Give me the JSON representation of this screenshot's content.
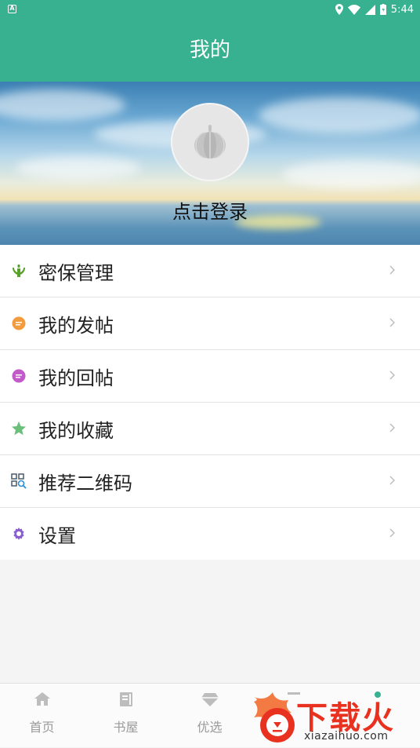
{
  "status_bar": {
    "time": "5:44",
    "notification_icon": "A"
  },
  "app_bar": {
    "title": "我的"
  },
  "profile": {
    "login_text": "点击登录",
    "avatar_icon": "pumpkin-icon"
  },
  "menu": [
    {
      "label": "密保管理",
      "icon": "security-hands-icon",
      "color": "#5aa02c"
    },
    {
      "label": "我的发帖",
      "icon": "chat-bubble-icon",
      "color": "#f39c3d"
    },
    {
      "label": "我的回帖",
      "icon": "chat-bubble-icon",
      "color": "#c25bc9"
    },
    {
      "label": "我的收藏",
      "icon": "star-icon",
      "color": "#6cbf7a"
    },
    {
      "label": "推荐二维码",
      "icon": "qr-search-icon",
      "color": "#6a7a8a"
    },
    {
      "label": "设置",
      "icon": "gear-icon",
      "color": "#8a5fd0"
    }
  ],
  "tabs": [
    {
      "label": "首页",
      "icon": "home-icon"
    },
    {
      "label": "书屋",
      "icon": "book-icon"
    },
    {
      "label": "优选",
      "icon": "diamond-icon"
    },
    {
      "label": "",
      "icon": "list-icon"
    },
    {
      "label": "",
      "icon": "person-icon"
    }
  ],
  "watermark": {
    "text": "下载火",
    "url": "xiazaihuo.com"
  },
  "colors": {
    "primary": "#37b18f",
    "background": "#f4f4f4",
    "accent_red": "#e8321f"
  }
}
